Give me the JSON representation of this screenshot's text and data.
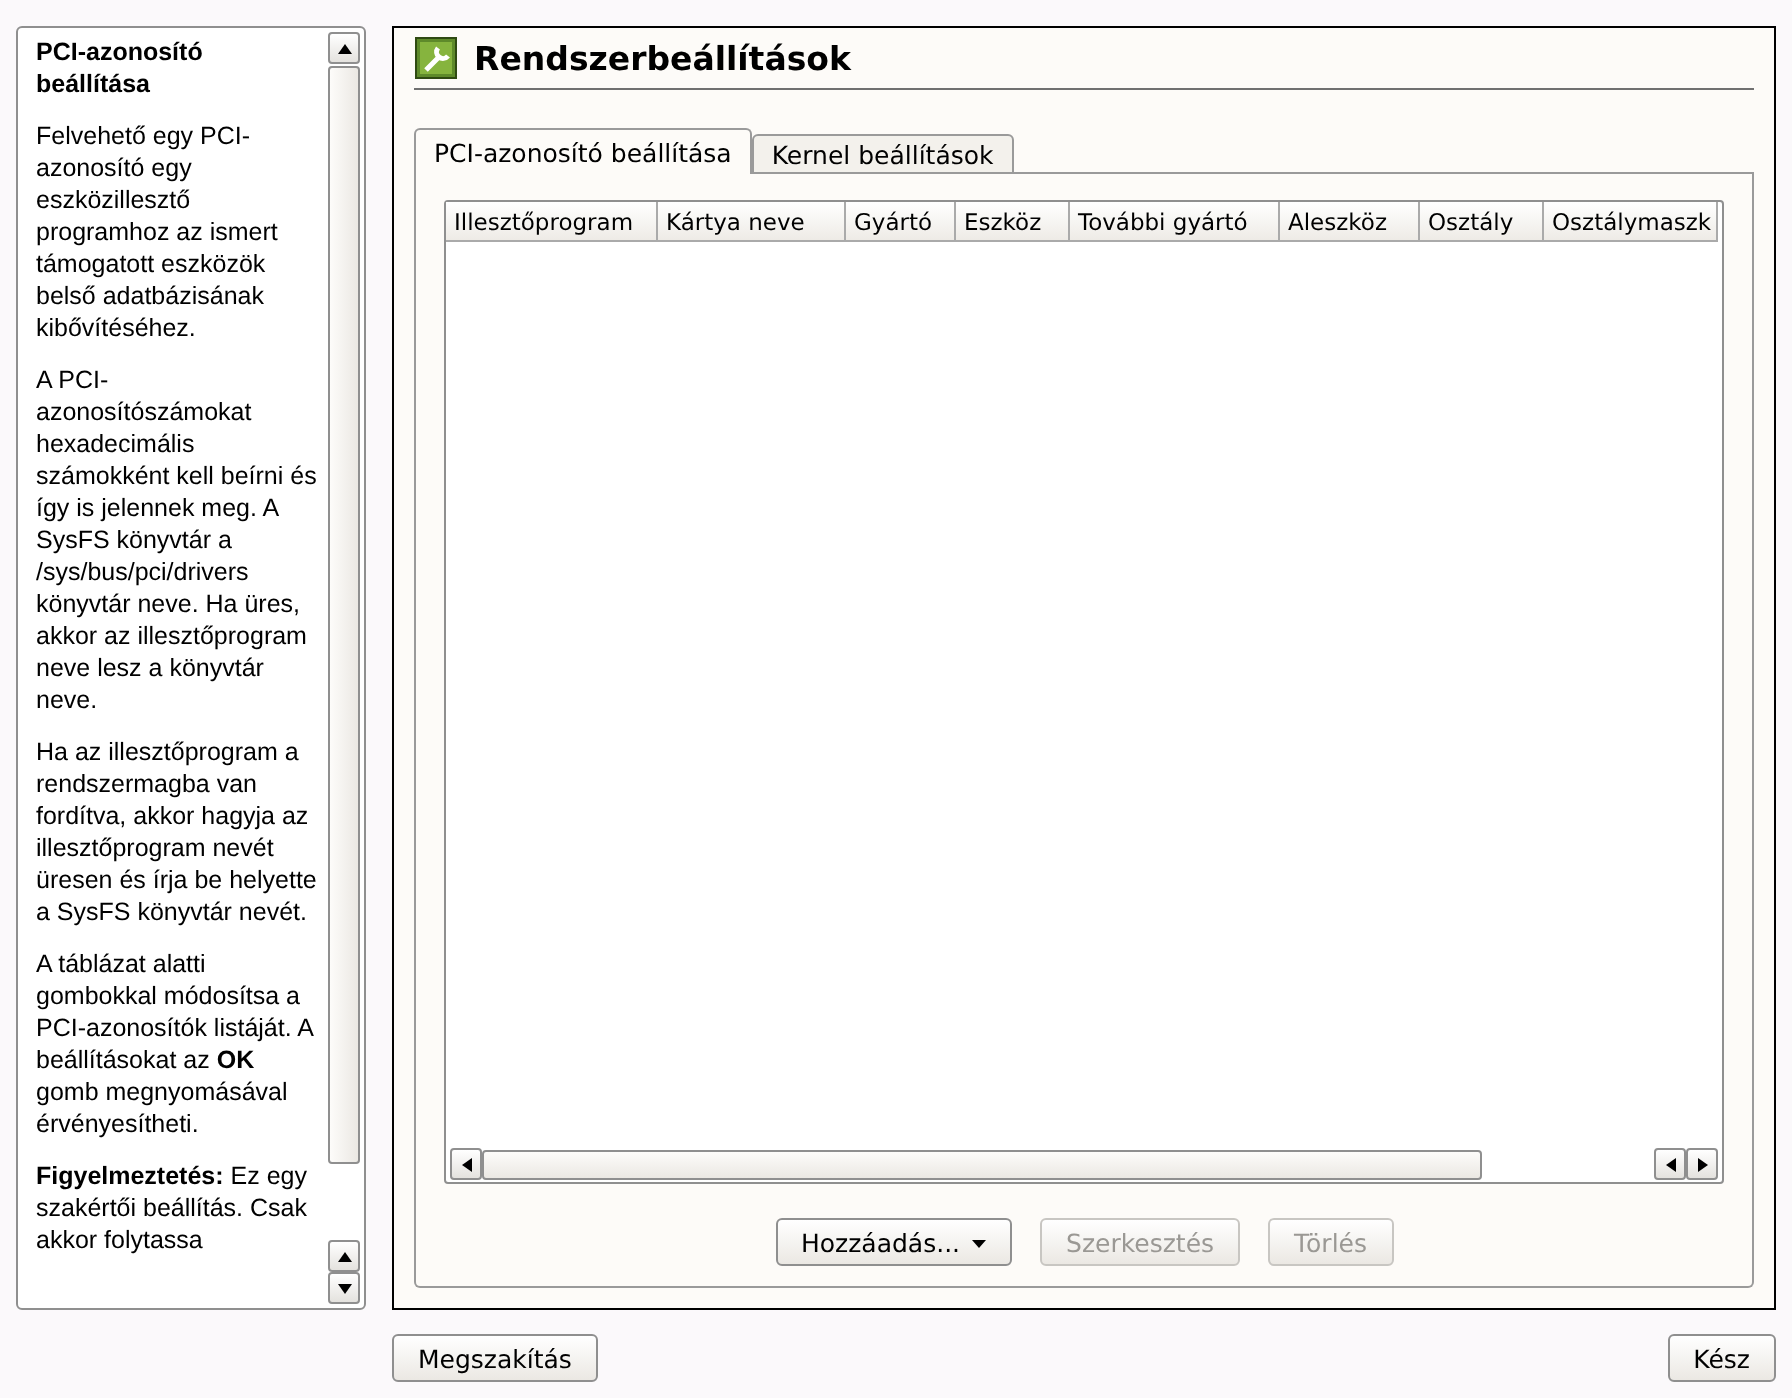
{
  "help": {
    "title": "PCI-azonosító beállítása",
    "paragraphs": [
      "Felvehető egy PCI-azonosító egy eszközillesztő programhoz az ismert támogatott eszközök belső adatbázisának kibővítéséhez.",
      "A PCI-azonosítószámokat hexadecimális számokként kell beírni és így is jelennek meg. A SysFS könyvtár a /sys/bus/pci/drivers könyvtár neve. Ha üres, akkor az illesztőprogram neve lesz a könyvtár neve.",
      "Ha az illesztőprogram a rendszermagba van fordítva, akkor hagyja az illesztőprogram nevét üresen és írja be helyette a SysFS könyvtár nevét.",
      "A táblázat alatti gombokkal módosítsa a PCI-azonosítók listáját. A beállításokat az **OK** gomb megnyomásával érvényesítheti.",
      "**Figyelmeztetés:** Ez egy szakértői beállítás. Csak akkor folytassa"
    ]
  },
  "window": {
    "title": "Rendszerbeállítások"
  },
  "tabs": [
    {
      "label": "PCI-azonosító beállítása",
      "selected": true
    },
    {
      "label": "Kernel beállítások",
      "selected": false
    }
  ],
  "table": {
    "columns": [
      "Illesztőprogram",
      "Kártya neve",
      "Gyártó",
      "Eszköz",
      "További gyártó",
      "Aleszköz",
      "Osztály",
      "Osztálymaszk"
    ]
  },
  "actions": [
    {
      "label": "Hozzáadás...",
      "kind": "menu",
      "disabled": false
    },
    {
      "label": "Szerkesztés",
      "kind": "plain",
      "disabled": true
    },
    {
      "label": "Törlés",
      "kind": "plain",
      "disabled": true
    }
  ],
  "footer": {
    "cancel": "Megszakítás",
    "done": "Kész"
  }
}
